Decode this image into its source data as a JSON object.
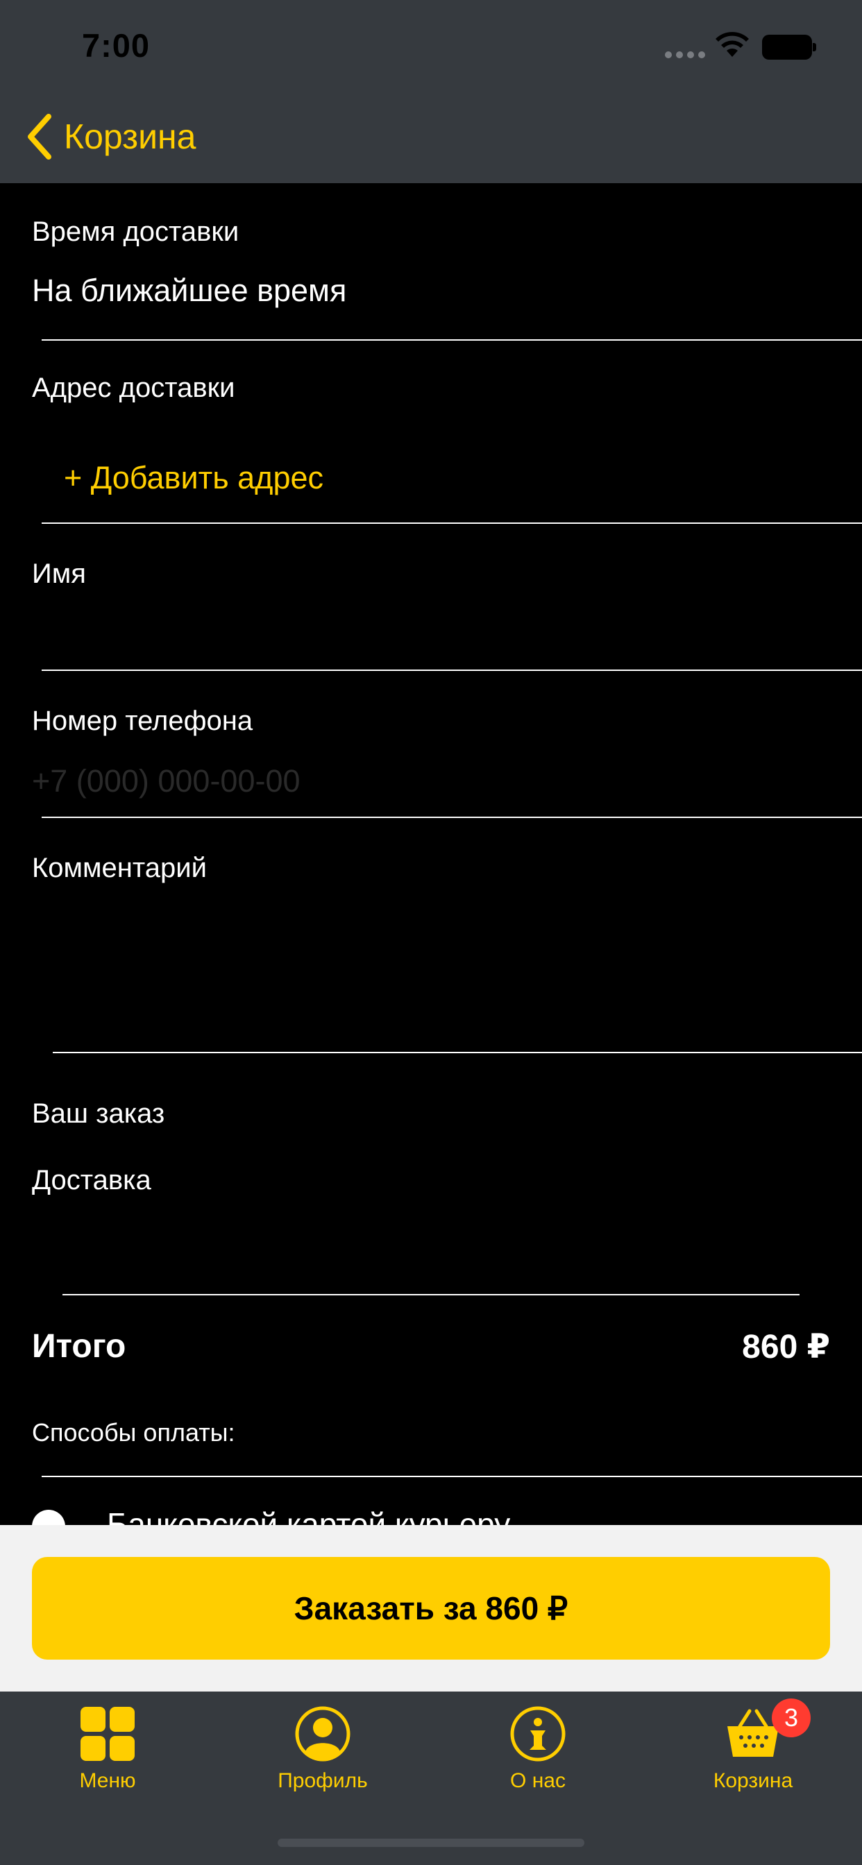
{
  "status_bar": {
    "time": "7:00"
  },
  "nav": {
    "back_label": "Корзина"
  },
  "form": {
    "delivery_time": {
      "label": "Время доставки",
      "value": "На ближайшее время"
    },
    "address": {
      "label": "Адрес доставки",
      "add_label": "+ Добавить адрес"
    },
    "name": {
      "label": "Имя",
      "value": ""
    },
    "phone": {
      "label": "Номер телефона",
      "placeholder": "+7 (000) 000-00-00"
    },
    "comment": {
      "label": "Комментарий",
      "value": ""
    }
  },
  "order": {
    "your_order_label": "Ваш заказ",
    "delivery_label": "Доставка",
    "total_label": "Итого",
    "total_value": "860 ₽",
    "payment_label": "Способы оплаты:",
    "payment_option": "Банковской картой курьеру"
  },
  "order_button": {
    "label": "Заказать за 860 ₽"
  },
  "tabbar": {
    "items": [
      {
        "label": "Меню",
        "icon": "grid-icon"
      },
      {
        "label": "Профиль",
        "icon": "profile-icon"
      },
      {
        "label": "О нас",
        "icon": "info-icon"
      },
      {
        "label": "Корзина",
        "icon": "basket-icon"
      }
    ],
    "cart_badge": "3"
  },
  "colors": {
    "accent": "#FFCE00",
    "bar_bg": "#363A3F",
    "badge": "#FF3B30"
  }
}
